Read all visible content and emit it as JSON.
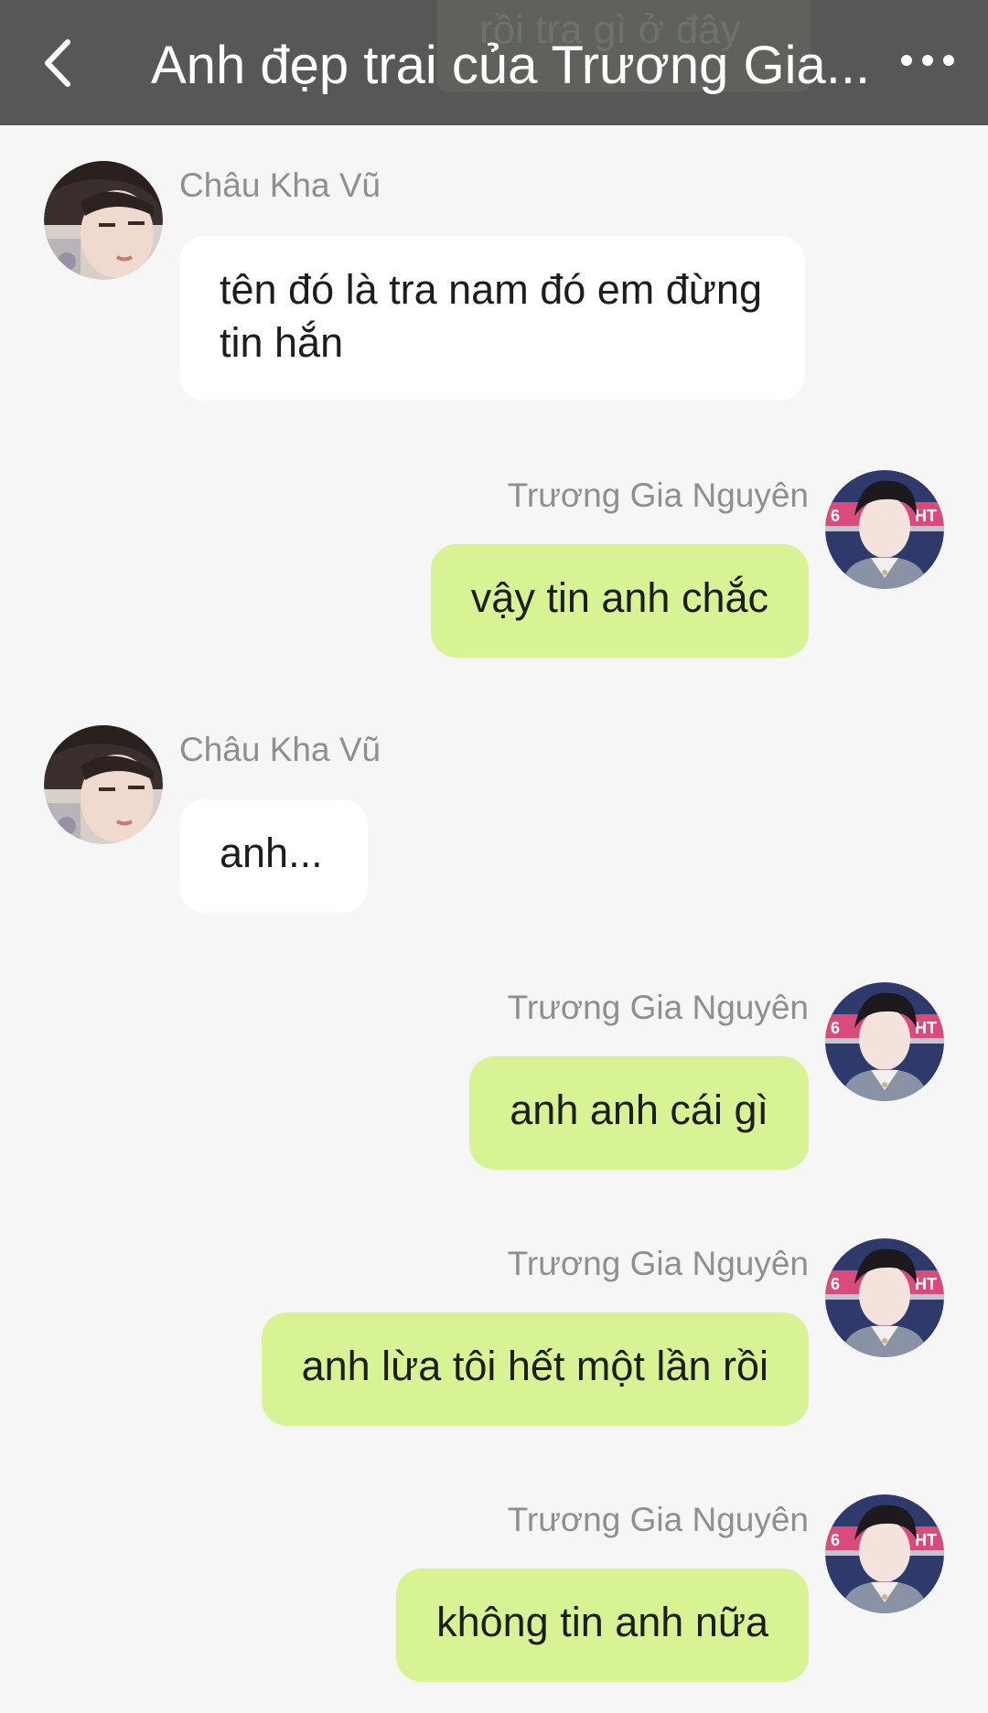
{
  "header": {
    "title": "Anh đẹp trai của Trương Gia...",
    "ghost_text": "rồi tra gì ở đây",
    "back_icon": "chevron-left-icon",
    "more_icon": "more-horizontal-icon"
  },
  "contacts": {
    "left_name": "Châu Kha Vũ",
    "right_name": "Trương Gia Nguyên"
  },
  "messages": [
    {
      "side": "left",
      "sender": "Châu Kha Vũ",
      "text": "tên đó là tra nam đó em đừng tin hắn"
    },
    {
      "side": "right",
      "sender": "Trương Gia Nguyên",
      "text": "vậy tin anh chắc"
    },
    {
      "side": "left",
      "sender": "Châu Kha Vũ",
      "text": "anh..."
    },
    {
      "side": "right",
      "sender": "Trương Gia Nguyên",
      "text": "anh anh cái gì"
    },
    {
      "side": "right",
      "sender": "Trương Gia Nguyên",
      "text": "anh lừa tôi hết một lần rồi"
    },
    {
      "side": "right",
      "sender": "Trương Gia Nguyên",
      "text": "không tin anh nữa"
    }
  ],
  "colors": {
    "header_bg": "#575757",
    "page_bg": "#f6f6f6",
    "bubble_left": "#ffffff",
    "bubble_right": "#d7f394",
    "sender_name": "#8f8f8f"
  }
}
